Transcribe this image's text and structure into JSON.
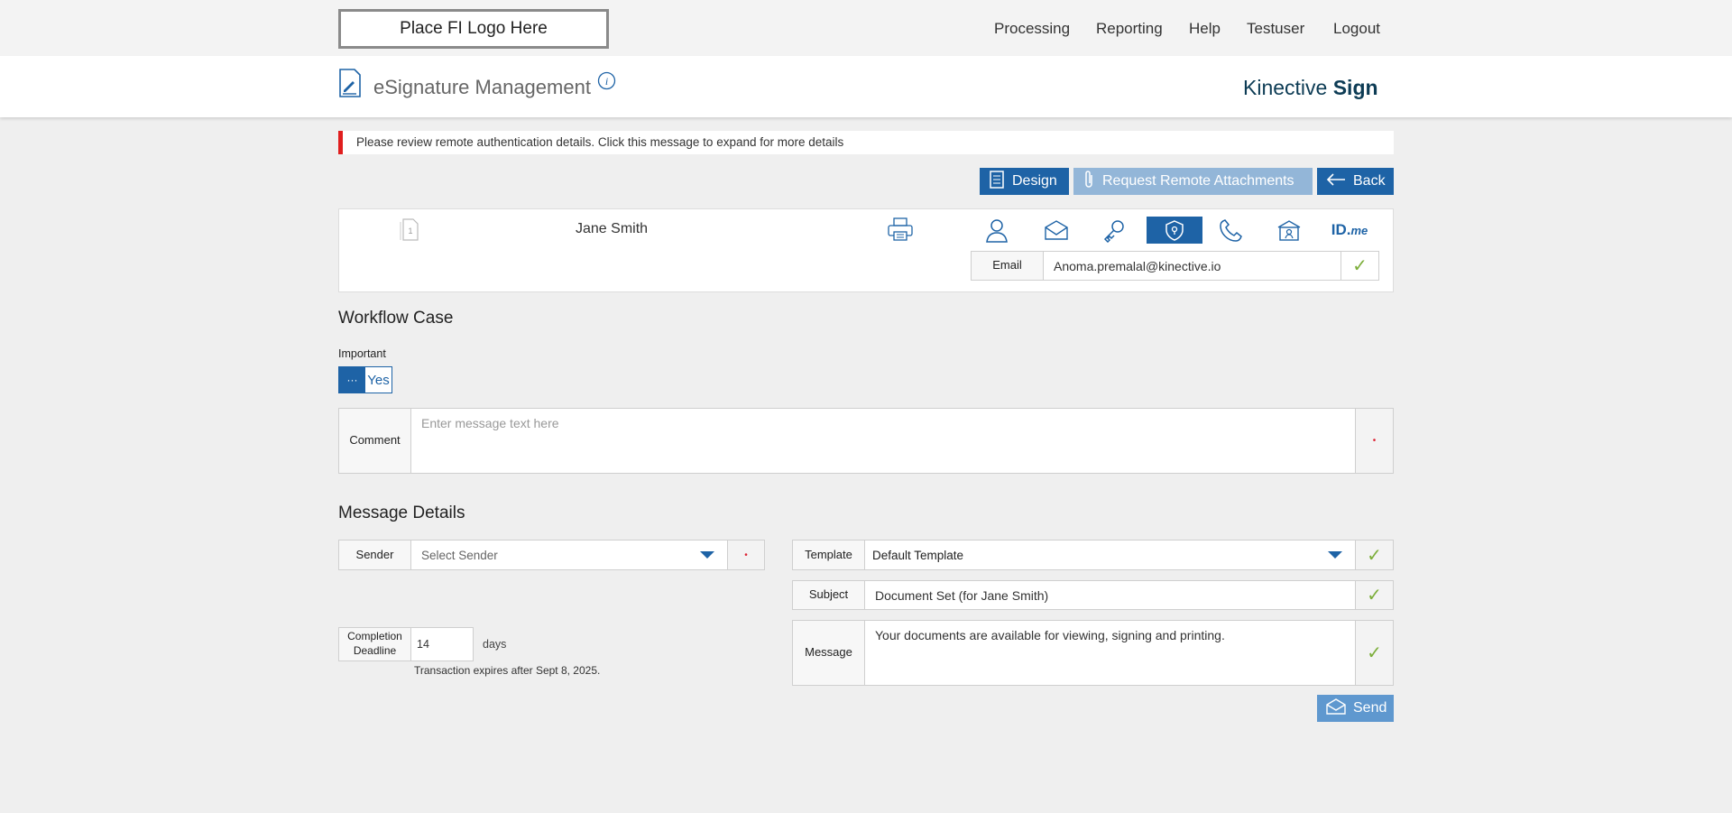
{
  "topbar": {
    "logo_placeholder": "Place FI Logo Here",
    "nav": [
      "Processing",
      "Reporting",
      "Help",
      "Testuser",
      "Logout"
    ]
  },
  "header": {
    "title": "eSignature Management",
    "brand_light": "Kinective ",
    "brand_bold": "Sign"
  },
  "alert": {
    "text": "Please review remote authentication details. Click this message to expand for more details",
    "color": "#e01e1e"
  },
  "toolbar": {
    "design_label": "Design",
    "attachments_label": "Request Remote Attachments",
    "back_label": "Back"
  },
  "recipient": {
    "document_count": "1",
    "name": "Jane Smith",
    "auth_icons": [
      "person-icon",
      "envelope-icon",
      "key-icon",
      "shield-icon",
      "phone-icon",
      "id-card-icon",
      "idme-logo"
    ],
    "selected_auth": "shield-icon",
    "idme_text": "ID.",
    "idme_suffix": "me",
    "email_label": "Email",
    "email_value": "Anoma.premalal@kinective.io"
  },
  "workflow": {
    "title": "Workflow Case",
    "important_label": "Important",
    "toggle_knob": "···",
    "toggle_value": "Yes",
    "comment_label": "Comment",
    "comment_placeholder": "Enter message text here",
    "required_mark": "•"
  },
  "message": {
    "title": "Message Details",
    "sender_label": "Sender",
    "sender_placeholder": "Select Sender",
    "deadline_label": "Completion Deadline",
    "deadline_value": "14",
    "days_label": "days",
    "expires_text": "Transaction expires after Sept 8, 2025.",
    "template_label": "Template",
    "template_value": "Default Template",
    "subject_label": "Subject",
    "subject_value": "Document Set (for Jane Smith)",
    "message_label": "Message",
    "message_value": "Your documents are available for viewing, signing and printing.",
    "check_mark": "✓",
    "send_label": "Send"
  },
  "colors": {
    "accent": "#1e63a6",
    "accent_light": "#93b6d8",
    "send_button": "#5f98cf",
    "check_green": "#7cae3a"
  }
}
